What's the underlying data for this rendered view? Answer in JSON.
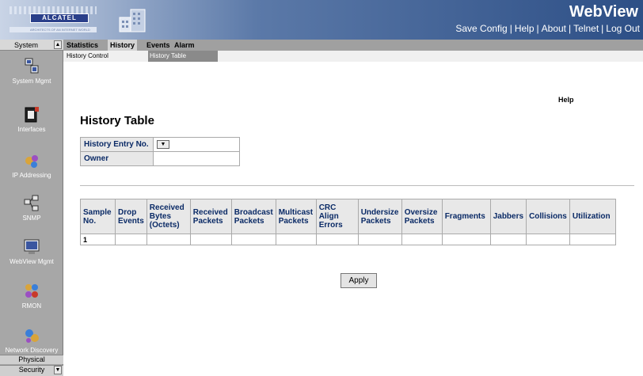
{
  "header": {
    "logo_text": "ALCATEL",
    "logo_tagline": "ARCHITECTS OF AN INTERNET WORLD",
    "app_title": "WebView",
    "links": [
      "Save Config",
      "Help",
      "About",
      "Telnet",
      "Log Out"
    ],
    "link_separator": "|"
  },
  "sidebar": {
    "top_label": "System",
    "items": [
      "System Mgmt",
      "Interfaces",
      "IP Addressing",
      "SNMP",
      "WebView Mgmt",
      "RMON",
      "Network Discovery"
    ],
    "bottom_labels": [
      "Physical",
      "Security"
    ]
  },
  "tabs": [
    "Statistics",
    "History",
    "Events",
    "Alarm"
  ],
  "subtabs": [
    "History Control",
    "History Table"
  ],
  "help_label": "Help",
  "page_title": "History Table",
  "form": {
    "entry_label": "History Entry No.",
    "entry_value": "",
    "owner_label": "Owner",
    "owner_value": ""
  },
  "table": {
    "headers": [
      [
        "Sample",
        "No."
      ],
      [
        "Drop",
        "Events"
      ],
      [
        "Received",
        "Bytes",
        "(Octets)"
      ],
      [
        "Received",
        "Packets"
      ],
      [
        "Broadcast",
        "Packets"
      ],
      [
        "Multicast",
        "Packets"
      ],
      [
        "CRC Align",
        "Errors"
      ],
      [
        "Undersize",
        "Packets"
      ],
      [
        "Oversize",
        "Packets"
      ],
      [
        "Fragments"
      ],
      [
        "Jabbers"
      ],
      [
        "Collisions"
      ],
      [
        "Utilization"
      ]
    ],
    "rows": [
      [
        "1",
        "",
        "",
        "",
        "",
        "",
        "",
        "",
        "",
        "",
        "",
        "",
        ""
      ]
    ]
  },
  "apply_label": "Apply",
  "colors": {
    "header_dark": "#2d4f86",
    "sidebar_bg": "#a7a7a7",
    "table_header_bg": "#e8e8e8",
    "label_text": "#0a2a66"
  }
}
